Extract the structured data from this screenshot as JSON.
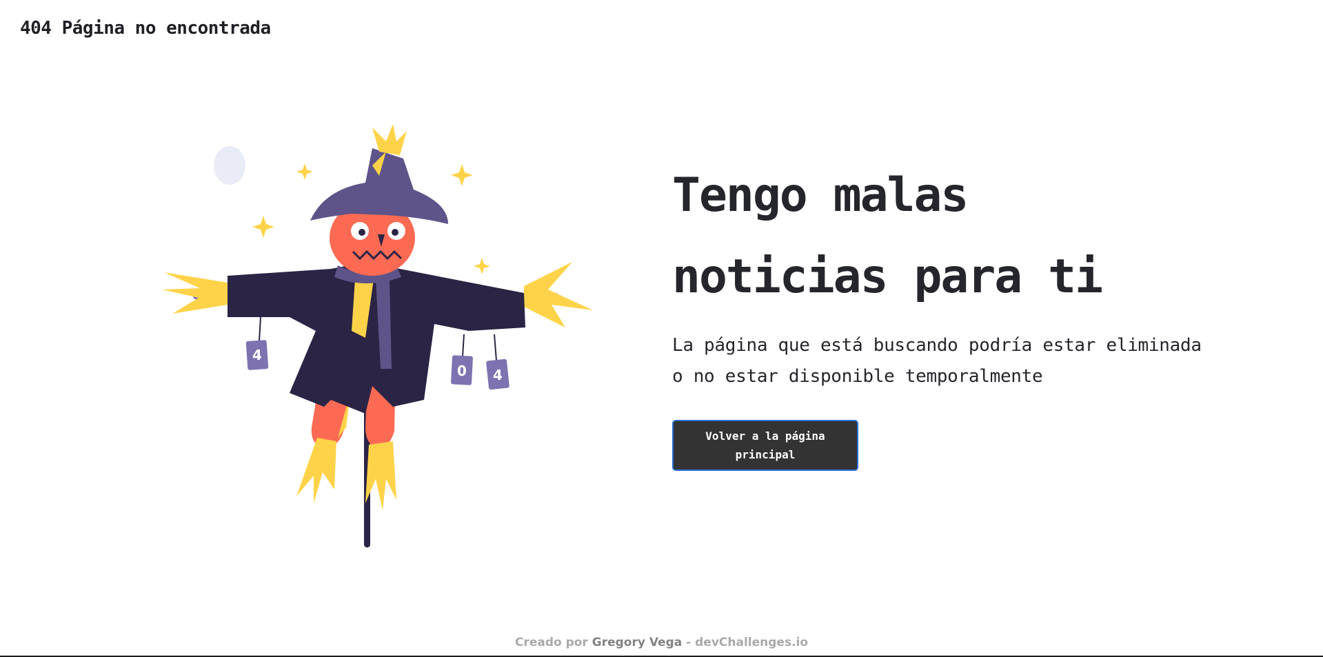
{
  "header": {
    "title": "404 Página no encontrada"
  },
  "illustration": {
    "cans": [
      "4",
      "0",
      "4"
    ]
  },
  "main": {
    "headline": "Tengo malas noticias para ti",
    "description": "La página que está buscando podría estar eliminada o no estar disponible temporalmente",
    "button_label": "Volver a la página principal"
  },
  "footer": {
    "prefix": "Creado por ",
    "author": "Gregory Vega",
    "separator": " - ",
    "site": "devChallenges.io"
  },
  "colors": {
    "button_bg": "#333333",
    "button_border": "#2b6fd8",
    "text": "#24262b",
    "footer_text": "#a9a9a9",
    "scarecrow_coat": "#2b2445",
    "scarecrow_hat": "#5e5489",
    "scarecrow_face": "#fd6a53",
    "straw": "#ffd349"
  }
}
